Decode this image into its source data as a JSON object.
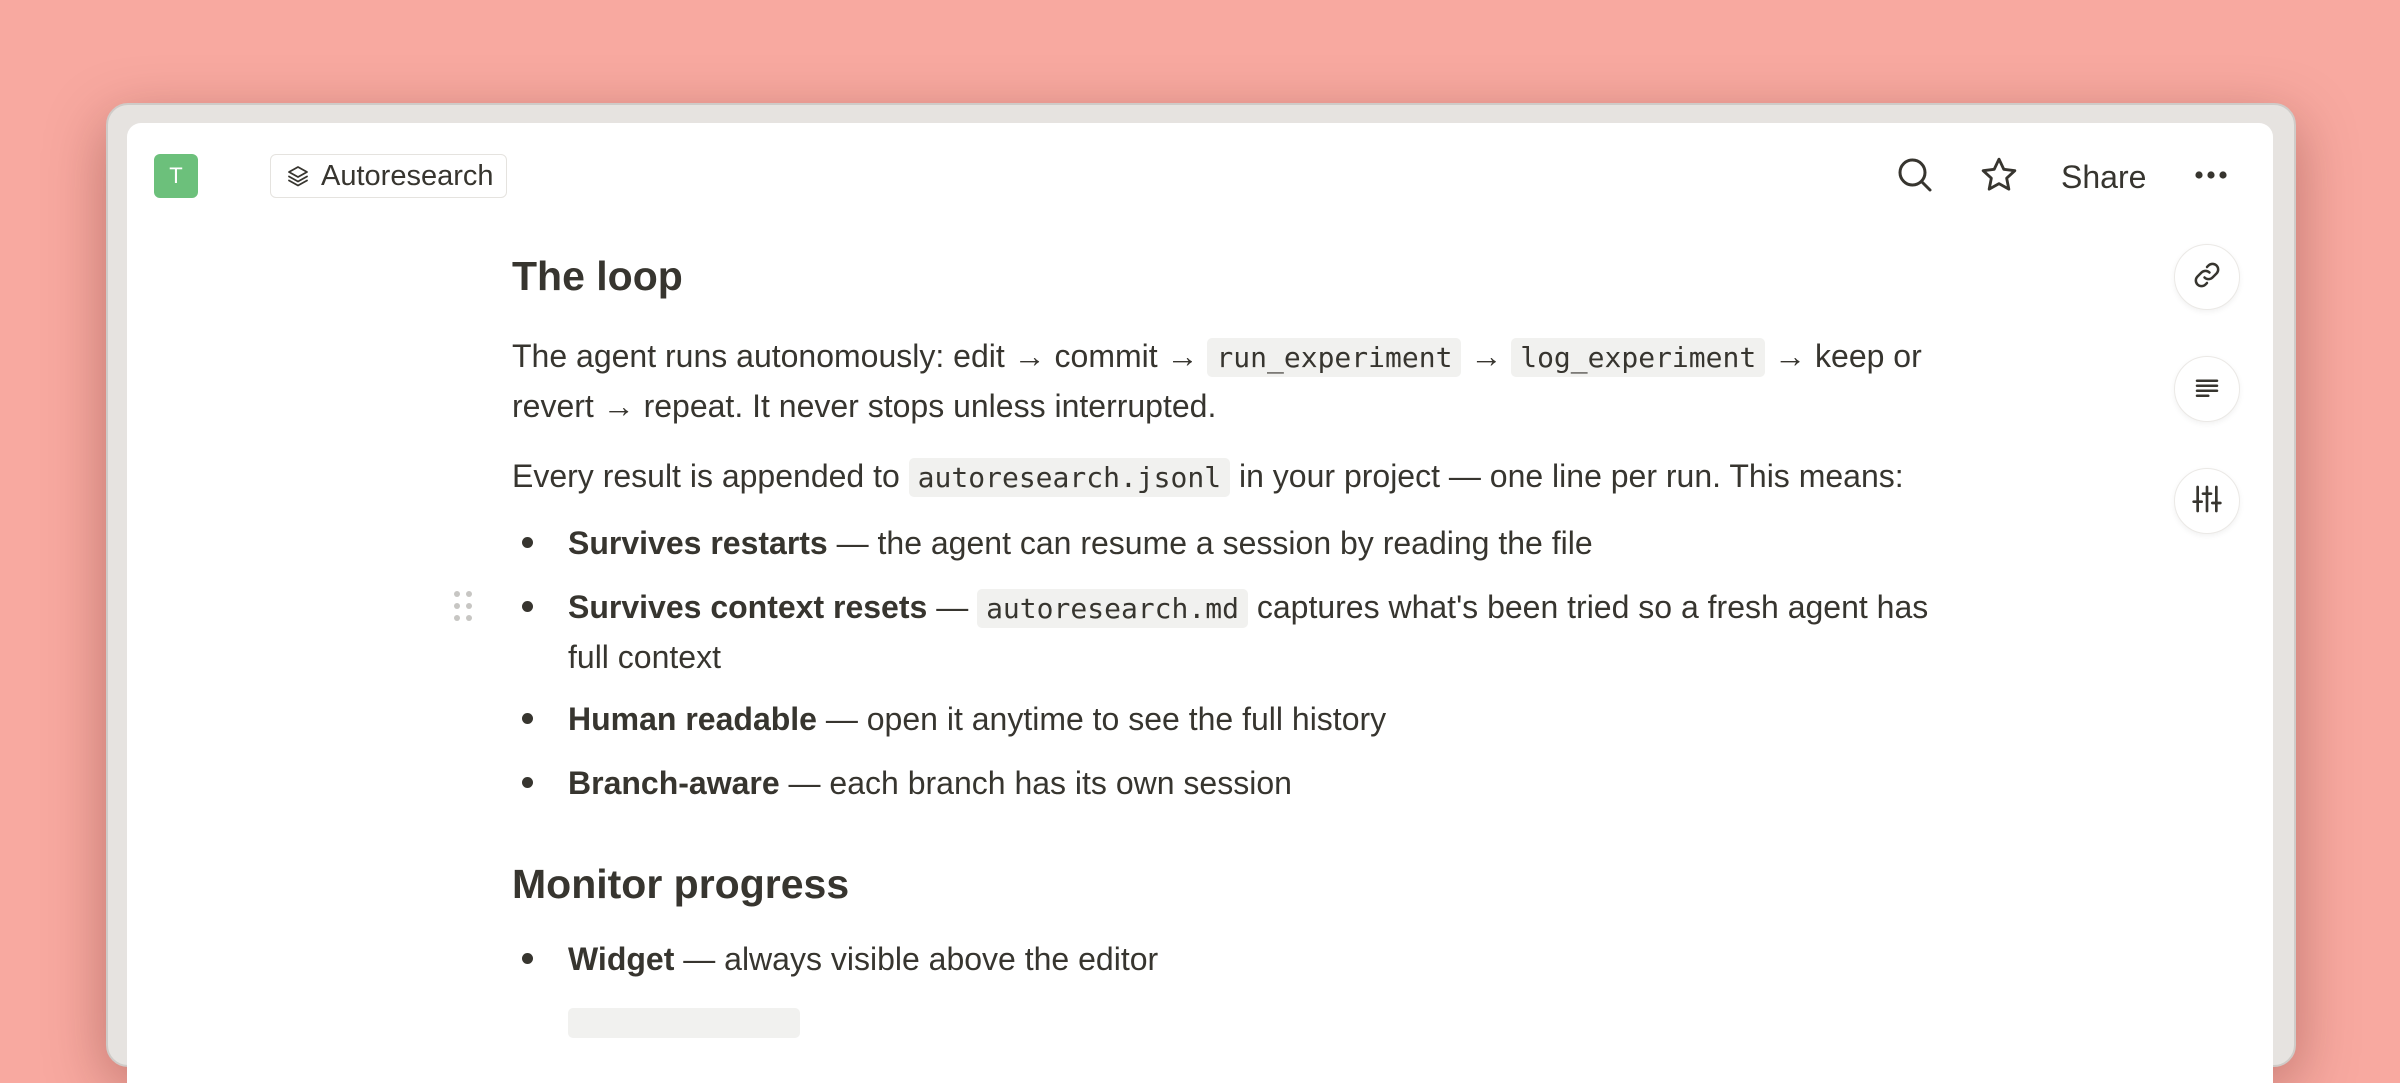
{
  "topbar": {
    "avatar_letter": "T",
    "page_title": "Autoresearch",
    "share_label": "Share"
  },
  "sections": {
    "loop": {
      "heading": "The loop",
      "p1": {
        "a": "The agent runs autonomously: edit → commit → ",
        "code1": "run_experiment",
        "b": " → ",
        "code2": "log_experiment",
        "c": " → keep or revert → repeat. It never stops unless interrupted."
      },
      "p2": {
        "a": "Every result is appended to ",
        "code": "autoresearch.jsonl",
        "b": " in your project — one line per run. This means:"
      },
      "bullets": [
        {
          "bold": "Survives restarts",
          "text": " — the agent can resume a session by reading the file"
        },
        {
          "bold": "Survives context resets",
          "text_a": " — ",
          "code": "autoresearch.md",
          "text_b": " captures what's been tried so a fresh agent has full context"
        },
        {
          "bold": "Human readable",
          "text": " — open it anytime to see the full history"
        },
        {
          "bold": "Branch-aware",
          "text": " — each branch has its own session"
        }
      ]
    },
    "monitor": {
      "heading": "Monitor progress",
      "bullets": [
        {
          "bold": "Widget",
          "text": " — always visible above the editor"
        }
      ]
    }
  },
  "icons": {
    "page_chip": "layers-icon",
    "search": "search-icon",
    "favorite": "star-icon",
    "more": "more-horizontal-icon",
    "copy_link": "link-icon",
    "outline": "text-align-left-icon",
    "settings": "sliders-icon"
  },
  "colors": {
    "background": "#f8a9a0",
    "avatar": "#6cc07b",
    "text": "#37352f",
    "code_bg": "#f1f1ef"
  }
}
